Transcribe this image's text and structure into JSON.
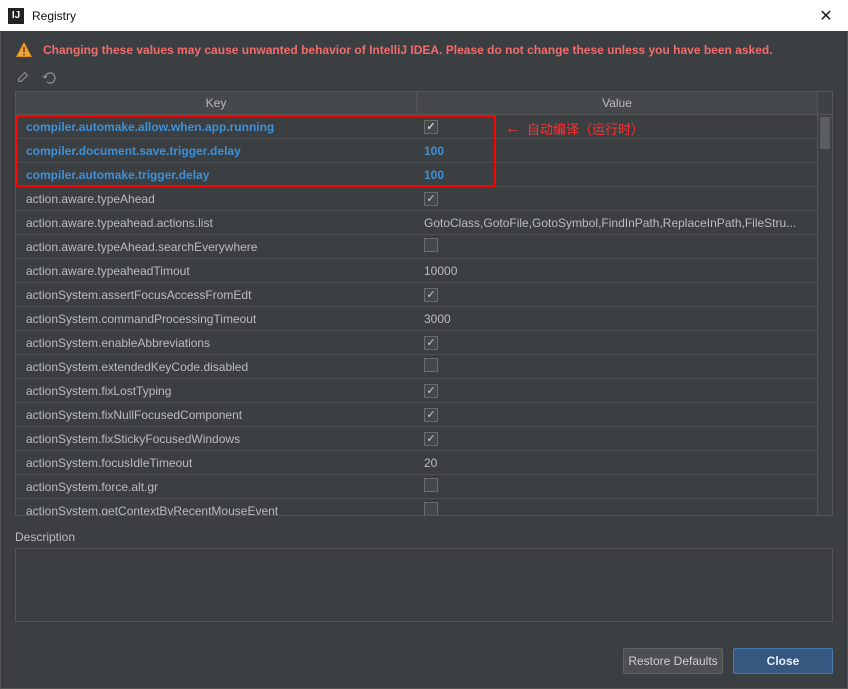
{
  "window": {
    "title": "Registry"
  },
  "warning": "Changing these values may cause unwanted behavior of IntelliJ IDEA. Please do not change these unless you have been asked.",
  "columns": {
    "key": "Key",
    "value": "Value"
  },
  "annotation": {
    "text": "自动编译（运行时）"
  },
  "rows": [
    {
      "key": "compiler.automake.allow.when.app.running",
      "type": "bool",
      "value": true,
      "highlight": true
    },
    {
      "key": "compiler.document.save.trigger.delay",
      "type": "text",
      "value": "100",
      "highlight": true
    },
    {
      "key": "compiler.automake.trigger.delay",
      "type": "text",
      "value": "100",
      "highlight": true
    },
    {
      "key": "action.aware.typeAhead",
      "type": "bool",
      "value": true
    },
    {
      "key": "action.aware.typeahead.actions.list",
      "type": "text",
      "value": "GotoClass,GotoFile,GotoSymbol,FindInPath,ReplaceInPath,FileStru..."
    },
    {
      "key": "action.aware.typeAhead.searchEverywhere",
      "type": "bool",
      "value": false
    },
    {
      "key": "action.aware.typeaheadTimout",
      "type": "text",
      "value": "10000"
    },
    {
      "key": "actionSystem.assertFocusAccessFromEdt",
      "type": "bool",
      "value": true
    },
    {
      "key": "actionSystem.commandProcessingTimeout",
      "type": "text",
      "value": "3000"
    },
    {
      "key": "actionSystem.enableAbbreviations",
      "type": "bool",
      "value": true
    },
    {
      "key": "actionSystem.extendedKeyCode.disabled",
      "type": "bool",
      "value": false
    },
    {
      "key": "actionSystem.fixLostTyping",
      "type": "bool",
      "value": true
    },
    {
      "key": "actionSystem.fixNullFocusedComponent",
      "type": "bool",
      "value": true
    },
    {
      "key": "actionSystem.fixStickyFocusedWindows",
      "type": "bool",
      "value": true
    },
    {
      "key": "actionSystem.focusIdleTimeout",
      "type": "text",
      "value": "20"
    },
    {
      "key": "actionSystem.force.alt.gr",
      "type": "bool",
      "value": false
    },
    {
      "key": "actionSystem.getContextByRecentMouseEvent",
      "type": "bool",
      "value": false
    }
  ],
  "description_label": "Description",
  "buttons": {
    "restore": "Restore Defaults",
    "close": "Close"
  }
}
